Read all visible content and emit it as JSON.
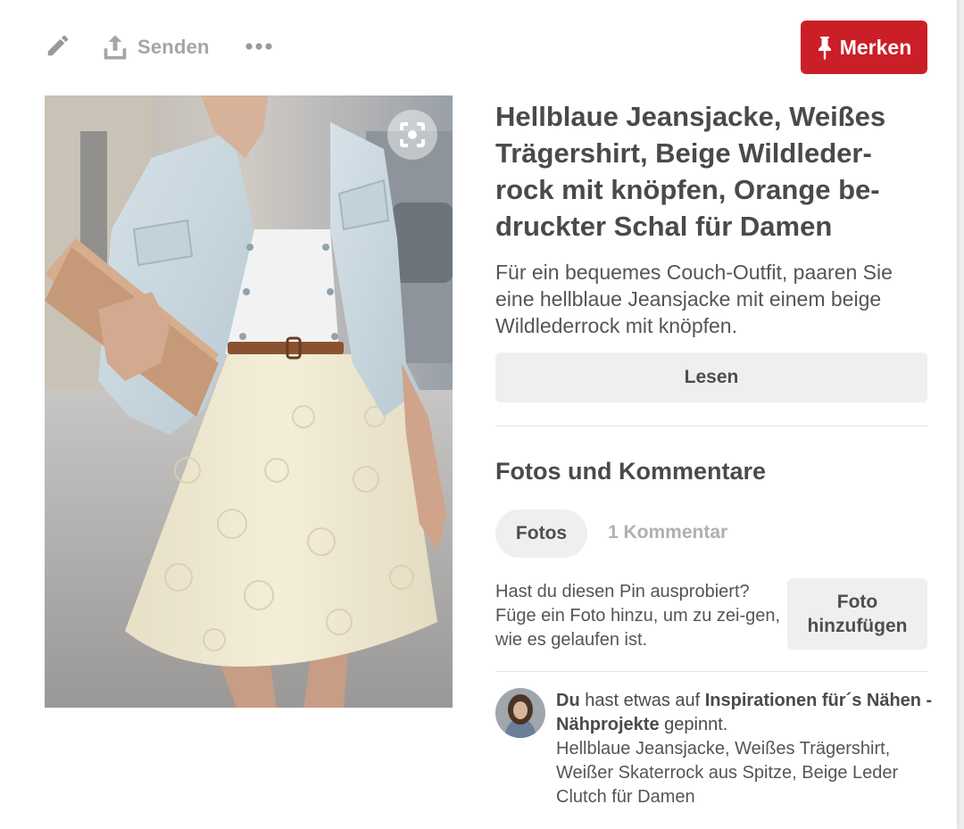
{
  "toolbar": {
    "edit_icon": "pencil-icon",
    "send_label": "Senden",
    "send_icon": "upload-icon",
    "more_icon": "ellipsis-icon",
    "save_label": "Merken",
    "save_icon": "pin-icon",
    "save_color": "#cb1f27"
  },
  "pin": {
    "image_alt_icon": "visual-search-icon",
    "title": "Hellblaue Jeansjacke, Weißes Trägershirt, Beige Wildleder-rock mit knöpfen, Orange be-druckter Schal für Damen",
    "description": "Für ein bequemes Couch-Outfit, paaren Sie eine hellblaue Jeansjacke mit einem beige Wildlederrock mit knöpfen.",
    "read_label": "Lesen"
  },
  "comments": {
    "section_title": "Fotos und Kommentare",
    "tab_photos": "Fotos",
    "tab_comments": "1 Kommentar",
    "tried_prompt": "Hast du diesen Pin ausprobiert? Füge ein Foto hinzu, um zu zei-gen, wie es gelaufen ist.",
    "add_photo_label": "Foto hinzufügen"
  },
  "activity": {
    "actor": "Du",
    "middle_text": " hast etwas auf ",
    "board": "Inspirationen für´s Nähen - Nähprojekte",
    "end_text": " gepinnt.",
    "pin_title": "Hellblaue Jeansjacke, Weißes Trägershirt, Weißer Skaterrock aus Spitze, Beige Leder Clutch für Damen"
  }
}
